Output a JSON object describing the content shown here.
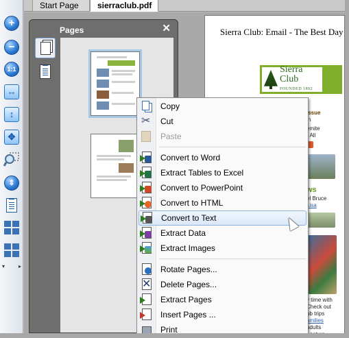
{
  "tabs": [
    {
      "label": "Start Page",
      "active": false
    },
    {
      "label": "sierraclub.pdf",
      "active": true
    }
  ],
  "toolbar": {
    "buttons": [
      {
        "name": "zoom-in-icon",
        "glyph": "+"
      },
      {
        "name": "zoom-out-icon",
        "glyph": "−"
      },
      {
        "name": "actual-size-icon",
        "glyph": "1:1"
      },
      {
        "name": "fit-width-icon",
        "glyph": "↔"
      },
      {
        "name": "fit-height-icon",
        "glyph": "↕"
      },
      {
        "name": "fit-page-icon",
        "glyph": "✥"
      },
      {
        "name": "zoom-select-icon",
        "glyph": ""
      },
      {
        "name": "scroll-icon",
        "glyph": ""
      },
      {
        "name": "single-page-icon",
        "glyph": ""
      },
      {
        "name": "two-page-icon",
        "glyph": ""
      },
      {
        "name": "continuous-icon",
        "glyph": ""
      }
    ]
  },
  "pages_panel": {
    "title": "Pages",
    "close_glyph": "✕"
  },
  "document": {
    "header_text": "Sierra Club: Email - The Best Day",
    "logo": {
      "line1": "Sierra",
      "line2": "Club",
      "tagline": "FOUNDED 1892"
    },
    "snippets": {
      "issue": "Issue",
      "r1": "in",
      "r2": "emite",
      "r3": "r All",
      "ws": "ws",
      "bruce": "el Bruce",
      "list": "Lisa",
      "time": "y time with",
      "check": "Check out",
      "trips": "ub trips",
      "amilies": "amilies",
      "adults": "adults",
      "nature": ", nature",
      "engaging": "e engaging"
    }
  },
  "context_menu": {
    "items": [
      {
        "label": "Copy",
        "icon": "copy-icon",
        "disabled": false
      },
      {
        "label": "Cut",
        "icon": "cut-icon",
        "disabled": false
      },
      {
        "label": "Paste",
        "icon": "paste-icon",
        "disabled": true
      },
      {
        "label": "Convert to Word",
        "icon": "convert-to-word-icon",
        "disabled": false
      },
      {
        "label": "Extract Tables to Excel",
        "icon": "extract-tables-excel-icon",
        "disabled": false
      },
      {
        "label": "Convert to PowerPoint",
        "icon": "convert-to-powerpoint-icon",
        "disabled": false
      },
      {
        "label": "Convert to HTML",
        "icon": "convert-to-html-icon",
        "disabled": false
      },
      {
        "label": "Convert to Text",
        "icon": "convert-to-text-icon",
        "disabled": false
      },
      {
        "label": "Extract Data",
        "icon": "extract-data-icon",
        "disabled": false
      },
      {
        "label": "Extract Images",
        "icon": "extract-images-icon",
        "disabled": false
      },
      {
        "label": "Rotate Pages...",
        "icon": "rotate-pages-icon",
        "disabled": false
      },
      {
        "label": "Delete Pages...",
        "icon": "delete-pages-icon",
        "disabled": false
      },
      {
        "label": "Extract Pages",
        "icon": "extract-pages-icon",
        "disabled": false
      },
      {
        "label": "Insert Pages ...",
        "icon": "insert-pages-icon",
        "disabled": false
      },
      {
        "label": "Print",
        "icon": "print-icon",
        "disabled": false
      }
    ],
    "hovered_item": "Convert to Text"
  },
  "colors": {
    "panel_bg": "#6e6e6e",
    "menu_hover": "#dbe8f8",
    "sierra_green": "#7fae2b",
    "word_blue": "#2b5797",
    "excel_green": "#217346",
    "ppt_red": "#d24726",
    "html_orange": "#e5642b"
  }
}
